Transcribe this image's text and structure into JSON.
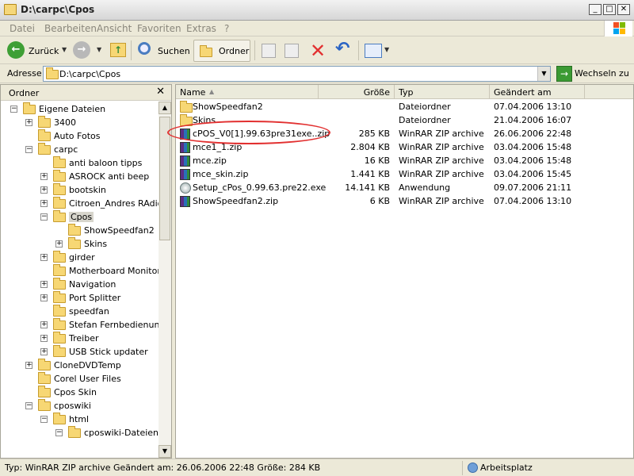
{
  "window": {
    "title": "D:\\carpc\\Cpos"
  },
  "menu": [
    "Datei",
    "Bearbeiten",
    "Ansicht",
    "Favoriten",
    "Extras",
    "?"
  ],
  "toolbar": {
    "back_label": "Zurück",
    "search_label": "Suchen",
    "folders_label": "Ordner"
  },
  "address": {
    "label": "Adresse",
    "value": "D:\\carpc\\Cpos",
    "go_label": "Wechseln zu"
  },
  "folder_pane": {
    "title": "Ordner",
    "items": [
      {
        "label": "Eigene Dateien",
        "level": 0,
        "expander": "−"
      },
      {
        "label": "3400",
        "level": 1,
        "expander": "+"
      },
      {
        "label": "Auto Fotos",
        "level": 1,
        "expander": ""
      },
      {
        "label": "carpc",
        "level": 1,
        "expander": "−"
      },
      {
        "label": "anti baloon tipps",
        "level": 2,
        "expander": ""
      },
      {
        "label": "ASROCK anti beep",
        "level": 2,
        "expander": "+"
      },
      {
        "label": "bootskin",
        "level": 2,
        "expander": "+"
      },
      {
        "label": "Citroen_Andres RAdio",
        "level": 2,
        "expander": "+"
      },
      {
        "label": "Cpos",
        "level": 2,
        "expander": "−",
        "selected": true
      },
      {
        "label": "ShowSpeedfan2",
        "level": 3,
        "expander": ""
      },
      {
        "label": "Skins",
        "level": 3,
        "expander": "+"
      },
      {
        "label": "girder",
        "level": 2,
        "expander": "+"
      },
      {
        "label": "Motherboard Monitor",
        "level": 2,
        "expander": ""
      },
      {
        "label": "Navigation",
        "level": 2,
        "expander": "+"
      },
      {
        "label": "Port Splitter",
        "level": 2,
        "expander": "+"
      },
      {
        "label": "speedfan",
        "level": 2,
        "expander": ""
      },
      {
        "label": "Stefan Fernbedienung",
        "level": 2,
        "expander": "+"
      },
      {
        "label": "Treiber",
        "level": 2,
        "expander": "+"
      },
      {
        "label": "USB Stick updater",
        "level": 2,
        "expander": "+"
      },
      {
        "label": "CloneDVDTemp",
        "level": 1,
        "expander": "+"
      },
      {
        "label": "Corel User Files",
        "level": 1,
        "expander": ""
      },
      {
        "label": "Cpos Skin",
        "level": 1,
        "expander": ""
      },
      {
        "label": "cposwiki",
        "level": 1,
        "expander": "−"
      },
      {
        "label": "html",
        "level": 2,
        "expander": "−"
      },
      {
        "label": "cposwiki-Dateien",
        "level": 3,
        "expander": "−"
      }
    ]
  },
  "file_list": {
    "columns": [
      "Name",
      "Größe",
      "Typ",
      "Geändert am"
    ],
    "rows": [
      {
        "name": "ShowSpeedfan2",
        "size": "",
        "type": "Dateiordner",
        "date": "07.04.2006 13:10",
        "icon": "folder-icon"
      },
      {
        "name": "Skins",
        "size": "",
        "type": "Dateiordner",
        "date": "21.04.2006 16:07",
        "icon": "folder-icon"
      },
      {
        "name": "cPOS_V0[1].99.63pre31exe..zip",
        "size": "285 KB",
        "type": "WinRAR ZIP archive",
        "date": "26.06.2006 22:48",
        "icon": "winrar-zip-icon"
      },
      {
        "name": "mce1_1.zip",
        "size": "2.804 KB",
        "type": "WinRAR ZIP archive",
        "date": "03.04.2006 15:48",
        "icon": "winrar-zip-icon"
      },
      {
        "name": "mce.zip",
        "size": "16 KB",
        "type": "WinRAR ZIP archive",
        "date": "03.04.2006 15:48",
        "icon": "winrar-zip-icon"
      },
      {
        "name": "mce_skin.zip",
        "size": "1.441 KB",
        "type": "WinRAR ZIP archive",
        "date": "03.04.2006 15:45",
        "icon": "winrar-zip-icon"
      },
      {
        "name": "Setup_cPos_0.99.63.pre22.exe",
        "size": "14.141 KB",
        "type": "Anwendung",
        "date": "09.07.2006 21:11",
        "icon": "setup-exe-icon"
      },
      {
        "name": "ShowSpeedfan2.zip",
        "size": "6 KB",
        "type": "WinRAR ZIP archive",
        "date": "07.04.2006 13:10",
        "icon": "winrar-zip-icon"
      }
    ]
  },
  "status": {
    "text": "Typ: WinRAR ZIP archive Geändert am: 26.06.2006 22:48 Größe: 284 KB",
    "zone": "Arbeitsplatz"
  },
  "colors": {
    "highlight_circle": "#e23030",
    "address_go": "#3b9a33"
  }
}
